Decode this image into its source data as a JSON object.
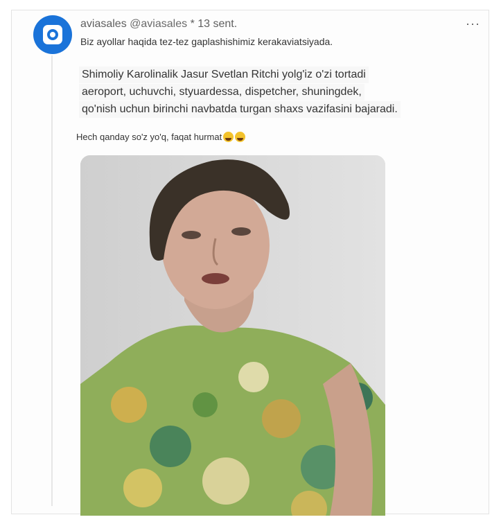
{
  "post": {
    "display_name": "aviasales",
    "handle": "@aviasales",
    "separator": "*",
    "date": "13 sent.",
    "subtitle": "Biz ayollar haqida tez-tez gaplashishimiz kerakaviatsiyada.",
    "body_lines": [
      "Shimoliy Karolinalik Jasur Svetlan Ritchi yolg'iz o'zi tortadi",
      "aeroport, uchuvchi, styuardessa, dispetcher, shuningdek,",
      "qo'nish uchun birinchi navbatda turgan shaxs vazifasini bajaradi."
    ],
    "reaction_text": "Hech qanday so'z yo'q, faqat hurmat",
    "reaction_icons": [
      "crying-face-icon",
      "crying-face-icon"
    ],
    "more_label": "···",
    "avatar_icon": "aviasales-logo-icon"
  },
  "colors": {
    "avatar_bg": "#1a73d9",
    "card_border": "#e3e3e3"
  }
}
